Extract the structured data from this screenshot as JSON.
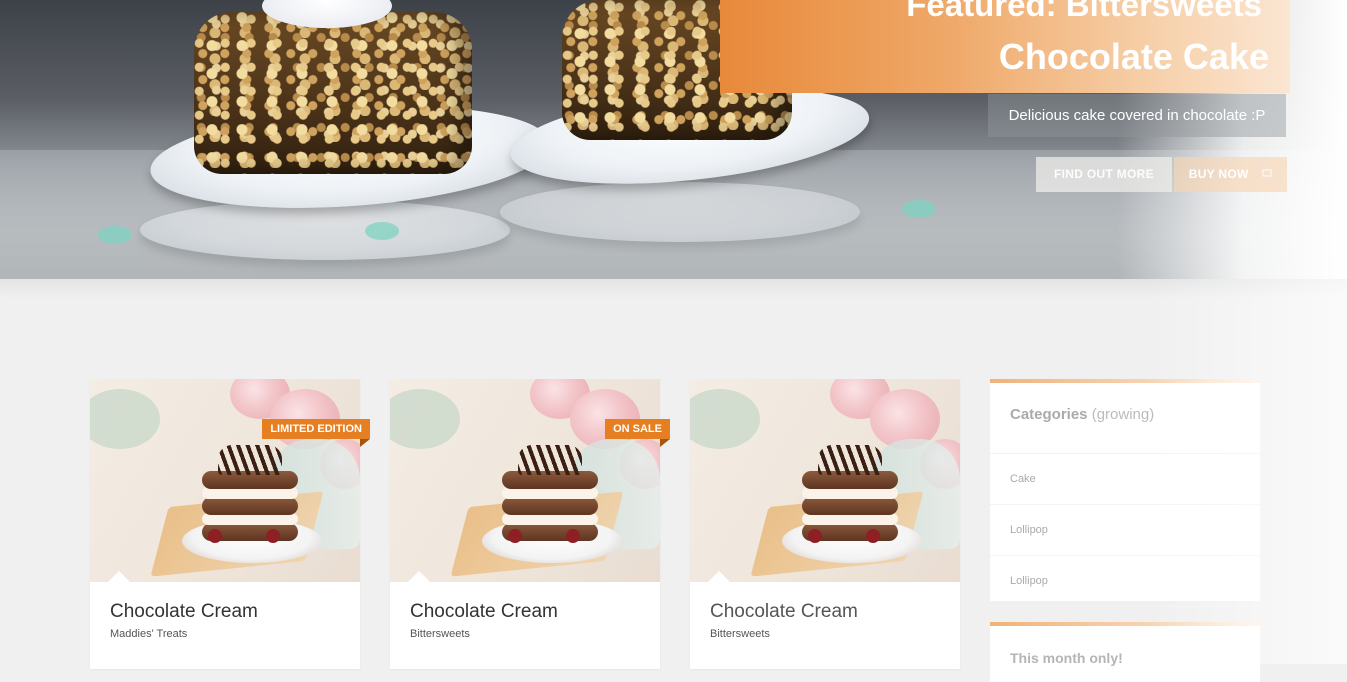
{
  "hero": {
    "title_line1": "Featured: Bittersweets",
    "title_line2": "Chocolate Cake",
    "subtitle": "Delicious cake covered in chocolate :P",
    "find_out_more_label": "FIND OUT MORE",
    "buy_now_label": "BUY NOW",
    "buy_now_icon": "cart-icon",
    "accent_color": "#e8893a"
  },
  "products": [
    {
      "name": "Chocolate Cream",
      "maker": "Maddies' Treats",
      "badge": "LIMITED EDITION"
    },
    {
      "name": "Chocolate Cream",
      "maker": "Bittersweets",
      "badge": "ON SALE"
    },
    {
      "name": "Chocolate Cream",
      "maker": "Bittersweets",
      "badge": ""
    }
  ],
  "badge_color": "#e67e22",
  "sidebar": {
    "categories": {
      "title": "Categories",
      "title_suffix": "(growing)",
      "items": [
        "Cake",
        "Lollipop",
        "Lollipop"
      ]
    },
    "this_month": {
      "title": "This month only!"
    }
  }
}
